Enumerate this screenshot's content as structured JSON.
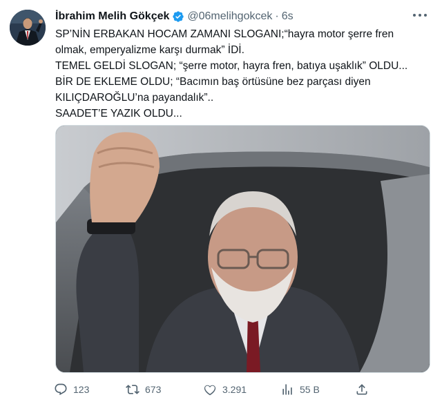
{
  "author": {
    "name": "İbrahim Melih Gökçek",
    "handle": "@06melihgokcek",
    "separator": "·",
    "time": "6s"
  },
  "tweet_lines": [
    "SP’NİN ERBAKAN HOCAM ZAMANI SLOGANI;“hayra motor şerre fren",
    "olmak, emperyalizme karşı durmak” İDİ.",
    "TEMEL GELDİ SLOGAN; “şerre motor, hayra fren, batıya uşaklık” OLDU...",
    "BİR DE EKLEME OLDU; “Bacımın baş örtüsüne bez parçası diyen",
    "KILIÇDAROĞLU’na payandalık”..",
    "SAADET’E YAZIK OLDU..."
  ],
  "actions": {
    "reply_count": "123",
    "retweet_count": "673",
    "like_count": "3.291",
    "views_count": "55 B"
  },
  "colors": {
    "verified": "#1d9bf0",
    "muted": "#536471",
    "text": "#0f1419"
  }
}
